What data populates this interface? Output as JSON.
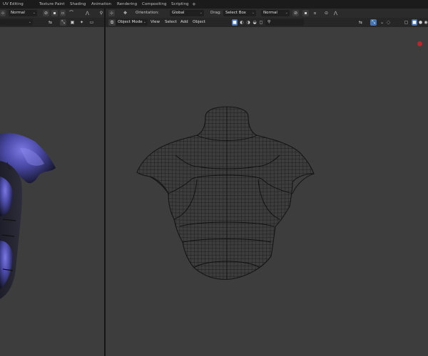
{
  "workspace_tabs": [
    "UV Editing",
    "Texture Paint",
    "Shading",
    "Animation",
    "Rendering",
    "Compositing",
    "Scripting",
    "+"
  ],
  "left_header": {
    "shading_dropdown": "Normal"
  },
  "main_header": {
    "orientation_label": "Orientation:",
    "orientation_value": "Global",
    "drag_label": "Drag:",
    "drag_value": "Select Box",
    "pivot_dropdown": "Normal"
  },
  "main_menu": {
    "mode": "Object Mode",
    "items": [
      "View",
      "Select",
      "Add",
      "Object"
    ]
  },
  "colors": {
    "accent": "#4772b3",
    "viewport_bg": "#3d3d3d",
    "header_bg": "#2b2b2b",
    "record_dot": "#b5282c",
    "armor_purple": "#4a4aa8"
  }
}
